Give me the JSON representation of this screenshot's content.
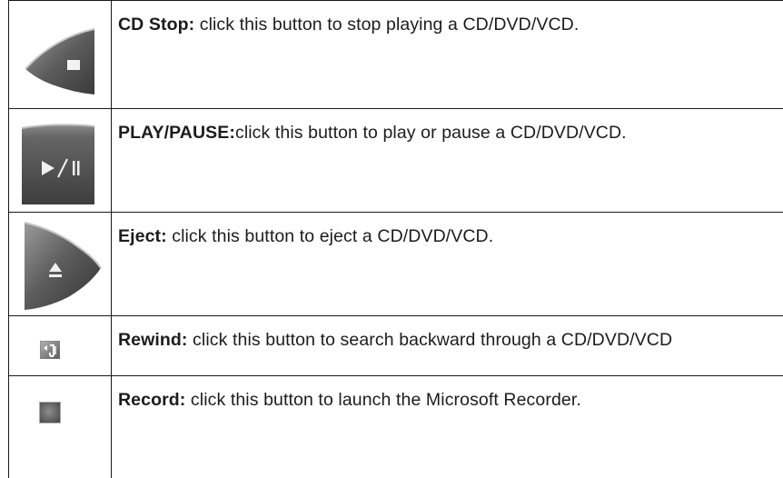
{
  "rows": [
    {
      "icon": "cd-stop-icon",
      "term": "CD Stop:",
      "desc": " click this button to stop playing a CD/DVD/VCD."
    },
    {
      "icon": "play-pause-icon",
      "term": "PLAY/PAUSE:",
      "desc": "click this button to play or pause a CD/DVD/VCD."
    },
    {
      "icon": "eject-icon",
      "term": "Eject:",
      "desc": " click this button to eject a CD/DVD/VCD."
    },
    {
      "icon": "rewind-icon",
      "term": "Rewind:",
      "desc": " click this button to search backward through a CD/DVD/VCD"
    },
    {
      "icon": "record-icon",
      "term": "Record:",
      "desc": " click this button to launch the Microsoft Recorder."
    }
  ]
}
